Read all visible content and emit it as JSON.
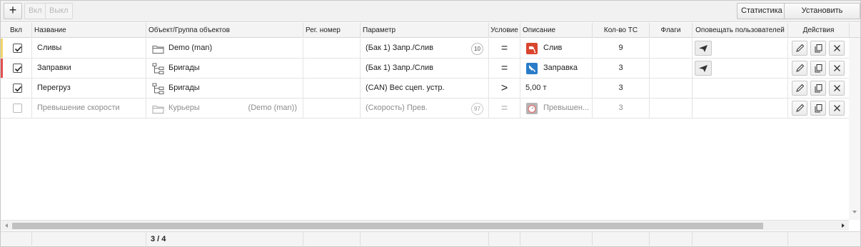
{
  "toolbar": {
    "add_icon": "plus-icon",
    "add_label": "+",
    "on_label": "Вкл",
    "off_label": "Выкл",
    "stats_label": "Статистика",
    "limits_label": "Установить лимиты"
  },
  "columns": {
    "on": "Вкл",
    "name": "Название",
    "object": "Объект/Группа объектов",
    "reg": "Рег. номер",
    "param": "Параметр",
    "cond": "Условие",
    "desc": "Описание",
    "count": "Кол-во ТС",
    "flags": "Флаги",
    "notify": "Оповещать пользователей",
    "actions": "Действия"
  },
  "rows": [
    {
      "enabled": true,
      "strip_color": "#f3d56b",
      "name": "Сливы",
      "object_icon": "folder-icon",
      "object": "Demo (man)",
      "object_owner": "",
      "param": "(Бак 1) Запр./Слив",
      "param_badge": "10",
      "cond": "=",
      "desc_icon": "fuel-drain-icon",
      "desc_icon_color": "#d9452e",
      "desc": "Слив",
      "count": "9",
      "notify": true
    },
    {
      "enabled": true,
      "strip_color": "#e35050",
      "name": "Заправки",
      "object_icon": "hierarchy-icon",
      "object": "Бригады",
      "object_owner": "",
      "param": "(Бак 1) Запр./Слив",
      "param_badge": "",
      "cond": "=",
      "desc_icon": "fuel-refill-icon",
      "desc_icon_color": "#2a7cc9",
      "desc": "Заправка",
      "count": "3",
      "notify": true
    },
    {
      "enabled": true,
      "strip_color": "",
      "name": "Перегруз",
      "object_icon": "hierarchy-icon",
      "object": "Бригады",
      "object_owner": "",
      "param": "(CAN) Вес сцеп. устр.",
      "param_badge": "",
      "cond": ">",
      "desc_icon": "",
      "desc_icon_color": "",
      "desc": "5,00 т",
      "count": "3",
      "notify": false
    },
    {
      "enabled": false,
      "strip_color": "",
      "name": "Превышение скорости",
      "object_icon": "folder-icon",
      "object": "Курьеры",
      "object_owner": "(Demo (man))",
      "param": "(Скорость) Прев.",
      "param_badge": "97",
      "cond": "=",
      "desc_icon": "speed-limit-icon",
      "desc_icon_color": "#b5b5b5",
      "desc": "Превышен...",
      "count": "3",
      "notify": false
    }
  ],
  "footer": {
    "counter": "3 / 4"
  }
}
